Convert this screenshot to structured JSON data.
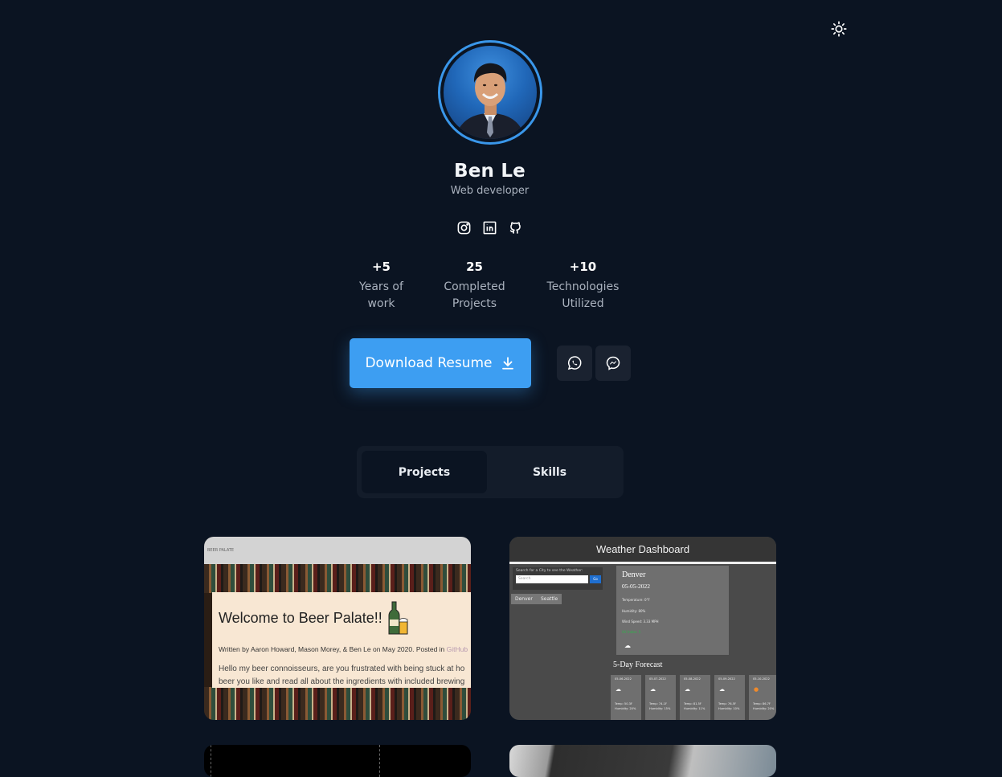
{
  "header": {
    "theme_toggle_icon": "sun-icon"
  },
  "profile": {
    "name": "Ben Le",
    "role": "Web developer",
    "avatar_alt": "avatar",
    "socials": [
      "instagram-icon",
      "linkedin-icon",
      "github-icon"
    ]
  },
  "stats": [
    {
      "value": "+5",
      "label_line1": "Years of",
      "label_line2": "work"
    },
    {
      "value": "25",
      "label_line1": "Completed",
      "label_line2": "Projects"
    },
    {
      "value": "+10",
      "label_line1": "Technologies",
      "label_line2": "Utilized"
    }
  ],
  "actions": {
    "resume_label": "Download Resume",
    "contact_icons": [
      "whatsapp-icon",
      "messenger-icon"
    ]
  },
  "tabs": [
    {
      "label": "Projects",
      "active": true
    },
    {
      "label": "Skills",
      "active": false
    }
  ],
  "projects": {
    "beer": {
      "header": "BEER PALATE",
      "title": "Welcome to Beer Palate!!",
      "byline": "Written by Aaron Howard, Mason Morey, & Ben Le on May 2020. Posted in",
      "byline_link": "GitHub",
      "body_line1": "Hello my beer connoisseurs, are you frustrated with being stuck at ho",
      "body_line2": "beer you like and read all about the ingredients with included brewing"
    },
    "weather": {
      "title": "Weather Dashboard",
      "search_label": "Search for a City to see the Weather:",
      "search_placeholder": "Search",
      "go_label": "Go",
      "chips": [
        "Denver",
        "Seattle"
      ],
      "city": "Denver",
      "date": "05-05-2022",
      "temperature": "Temperature: 0°F",
      "humidity": "Humidity: 80%",
      "wind": "Wind Speed: 3.33 MPH",
      "uv": "UV Index: 5",
      "forecast_title": "5-Day Forecast",
      "forecast": [
        {
          "date": "05-06-2022",
          "temp": "Temp: 50.3F",
          "hum": "Humidity: 20%"
        },
        {
          "date": "05-07-2022",
          "temp": "Temp: 74.1F",
          "hum": "Humidity: 15%"
        },
        {
          "date": "05-08-2022",
          "temp": "Temp: 81.5F",
          "hum": "Humidity: 11%"
        },
        {
          "date": "05-09-2022",
          "temp": "Temp: 76.5F",
          "hum": "Humidity: 10%"
        },
        {
          "date": "05-10-2022",
          "temp": "Temp: 86.7F",
          "hum": "Humidity: 20%"
        }
      ]
    }
  },
  "colors": {
    "background": "#0b1422",
    "accent": "#3d9ef2",
    "ring": "#3a97ea"
  }
}
